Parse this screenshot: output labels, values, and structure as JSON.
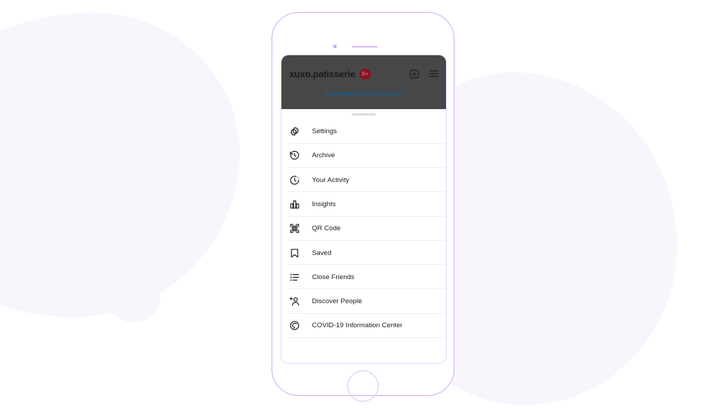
{
  "app": {
    "header": {
      "username": "xuxo.patisserie",
      "notification_badge": "9+",
      "add_icon": "plus-square-icon",
      "menu_icon": "hamburger-menu-icon",
      "professional_dashboard_link": "View Professional Dashboard",
      "overlay_color": "#474747",
      "link_color": "#1f5d8a",
      "badge_color": "#8b1220"
    },
    "sheet": {
      "grabber": "drag-handle",
      "items": [
        {
          "label": "Settings",
          "icon": "gear-icon"
        },
        {
          "label": "Archive",
          "icon": "archive-clock-icon"
        },
        {
          "label": "Your Activity",
          "icon": "activity-clock-icon"
        },
        {
          "label": "Insights",
          "icon": "bar-chart-icon"
        },
        {
          "label": "QR Code",
          "icon": "qr-code-icon"
        },
        {
          "label": "Saved",
          "icon": "bookmark-icon"
        },
        {
          "label": "Close Friends",
          "icon": "list-icon"
        },
        {
          "label": "Discover People",
          "icon": "add-person-icon"
        },
        {
          "label": "COVID-19 Information Center",
          "icon": "covid-info-icon"
        }
      ]
    }
  },
  "device": {
    "camera": "front-camera-dot",
    "speaker": "earpiece-speaker",
    "home_button": "home-button",
    "frame_color": "#cfa8f5"
  },
  "background": {
    "blob_color": "#f8f5fd",
    "page_color": "#ffffff"
  }
}
